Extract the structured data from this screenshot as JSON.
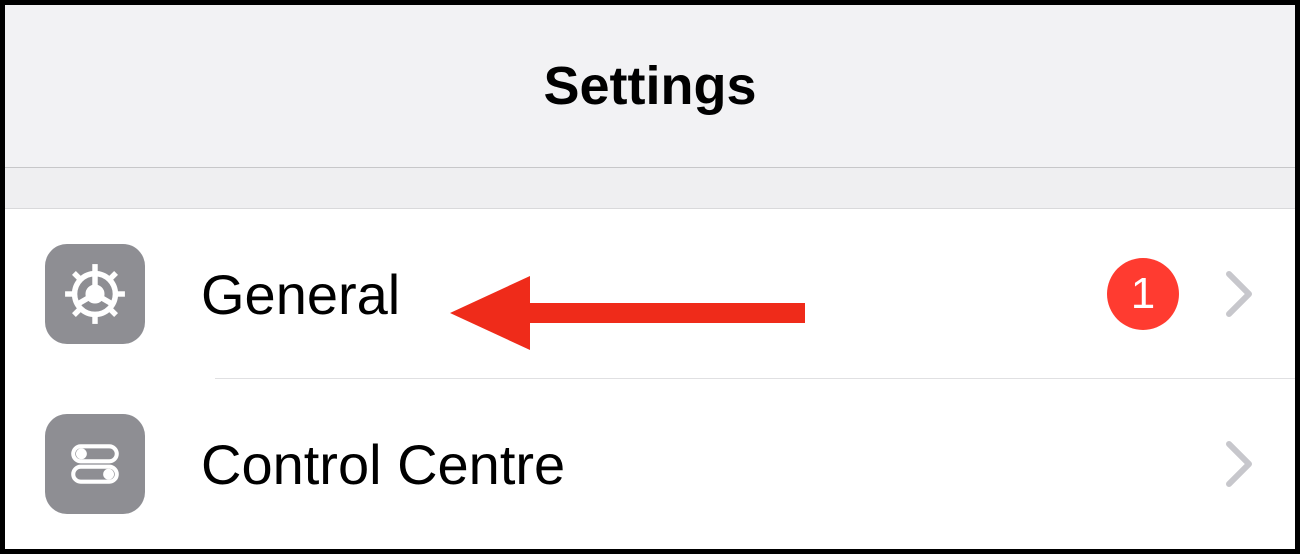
{
  "header": {
    "title": "Settings"
  },
  "rows": [
    {
      "label": "General",
      "icon": "gear-icon",
      "badge": "1"
    },
    {
      "label": "Control Centre",
      "icon": "toggles-icon",
      "badge": null
    }
  ],
  "colors": {
    "badge": "#ff3b30",
    "iconBg": "#8e8e93",
    "annotationArrow": "#ef2b1a"
  }
}
